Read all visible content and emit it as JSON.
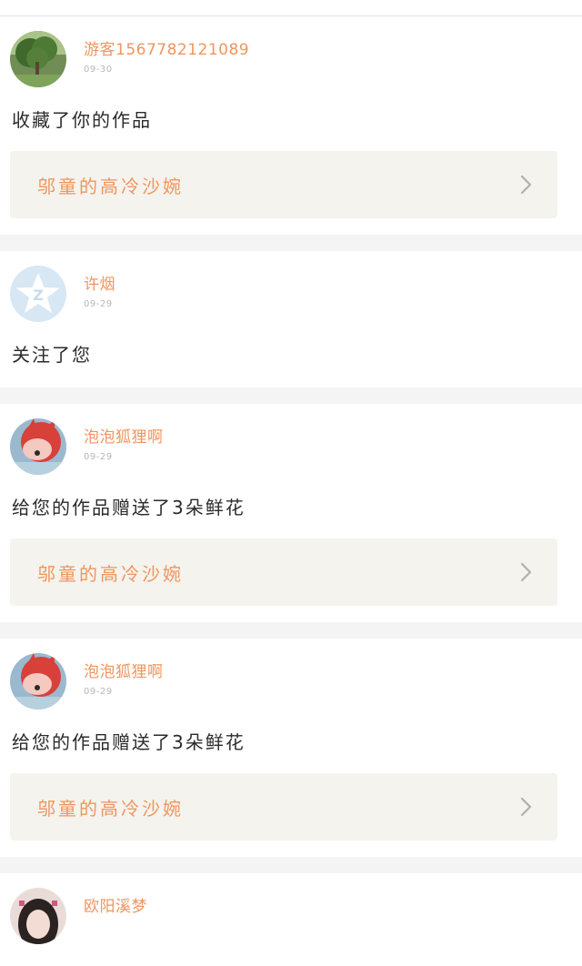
{
  "feed": {
    "items": [
      {
        "username": "游客1567782121089",
        "date": "09-30",
        "message": "收藏了你的作品",
        "work_title": "邬童的高冷沙婉",
        "avatar": "tree-photo"
      },
      {
        "username": "许烟",
        "date": "09-29",
        "message": "关注了您",
        "work_title": null,
        "avatar": "qzone-star-icon"
      },
      {
        "username": "泡泡狐狸啊",
        "date": "09-29",
        "message": "给您的作品赠送了3朵鲜花",
        "work_title": "邬童的高冷沙婉",
        "avatar": "red-fox-cartoon"
      },
      {
        "username": "泡泡狐狸啊",
        "date": "09-29",
        "message": "给您的作品赠送了3朵鲜花",
        "work_title": "邬童的高冷沙婉",
        "avatar": "red-fox-cartoon"
      },
      {
        "username": "欧阳溪梦",
        "avatar": "girl-photo"
      }
    ]
  },
  "colors": {
    "accent": "#f0955e",
    "link_bg": "#f4f3ed",
    "separator": "#f4f4f4",
    "text": "#2b2b2b",
    "date": "#b7b7b7"
  }
}
